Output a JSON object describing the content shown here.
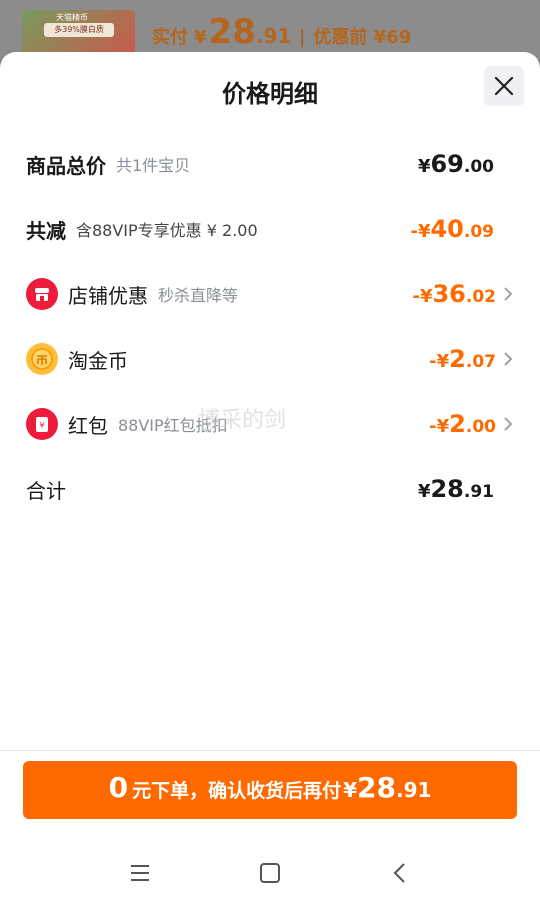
{
  "background": {
    "thumb_tag": "天猫精币",
    "thumb_pill": "多39%膜白质",
    "price_label": "实付",
    "price_currency": "¥",
    "price_int": "28",
    "price_dec": ".91",
    "separator": "|",
    "before_label": "优惠前 ¥69"
  },
  "sheet": {
    "title": "价格明细",
    "close_icon": "close-icon"
  },
  "rows": {
    "total": {
      "label": "商品总价",
      "sub": "共1件宝贝",
      "cur": "¥",
      "int": "69",
      "dec": ".00"
    },
    "reduce": {
      "label": "共减",
      "sub": "含88VIP专享优惠 ¥ 2.00",
      "cur": "-¥",
      "int": "40",
      "dec": ".09"
    },
    "shop": {
      "label": "店铺优惠",
      "sub": "秒杀直降等",
      "cur": "-¥",
      "int": "36",
      "dec": ".02",
      "icon": "shop-icon"
    },
    "coin": {
      "label": "淘金币",
      "sub": "",
      "cur": "-¥",
      "int": "2",
      "dec": ".07",
      "icon": "coin-icon"
    },
    "redpacket": {
      "label": "红包",
      "sub": "88VIP红包抵扣",
      "cur": "-¥",
      "int": "2",
      "dec": ".00",
      "icon": "redpacket-icon"
    },
    "sum": {
      "label": "合计",
      "cur": "¥",
      "int": "28",
      "dec": ".91"
    }
  },
  "cta": {
    "zero": "0",
    "text": "元下单，确认收货后再付",
    "cur": "¥",
    "int": "28",
    "dec": ".91"
  },
  "watermark": "博采的剑",
  "colors": {
    "accent": "#ff6a00",
    "red_icon": "#ee1c3b",
    "gold_icon": "#ffbd3a"
  }
}
